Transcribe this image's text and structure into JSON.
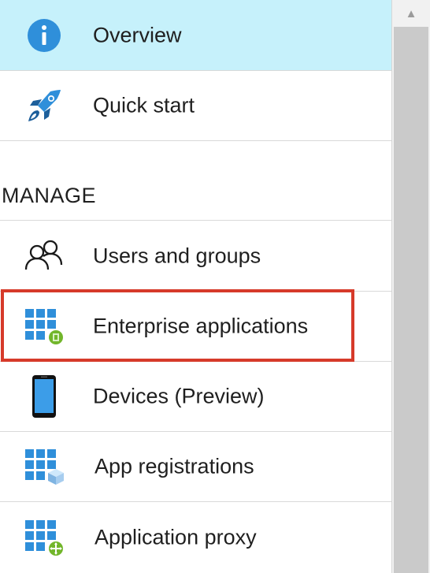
{
  "menu": {
    "items": [
      {
        "label": "Overview",
        "icon": "info-icon",
        "active": true
      },
      {
        "label": "Quick start",
        "icon": "rocket-icon",
        "active": false
      }
    ],
    "section": {
      "title": "MANAGE",
      "items": [
        {
          "label": "Users and groups",
          "icon": "users-icon"
        },
        {
          "label": "Enterprise applications",
          "icon": "enterprise-apps-icon",
          "highlighted": true
        },
        {
          "label": "Devices (Preview)",
          "icon": "device-icon"
        },
        {
          "label": "App registrations",
          "icon": "app-registrations-icon"
        },
        {
          "label": "Application proxy",
          "icon": "application-proxy-icon"
        }
      ]
    }
  },
  "colors": {
    "active_background": "#c6f1fb",
    "highlight_border": "#d63a2a",
    "icon_blue": "#2f8fda",
    "icon_green": "#72b62b"
  },
  "scrollbar": {
    "up_arrow": "▲"
  }
}
